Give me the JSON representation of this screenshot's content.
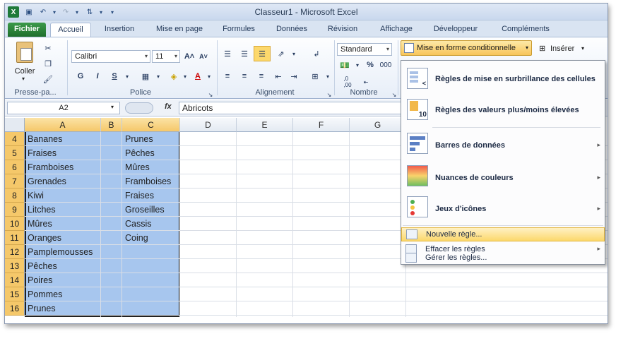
{
  "window": {
    "title": "Classeur1 - Microsoft Excel"
  },
  "tabs": [
    "Fichier",
    "Accueil",
    "Insertion",
    "Mise en page",
    "Formules",
    "Données",
    "Révision",
    "Affichage",
    "Développeur",
    "Compléments"
  ],
  "ribbon": {
    "paste_label": "Coller",
    "font_name": "Calibri",
    "font_size": "11",
    "bold": "G",
    "italic": "I",
    "underline": "S",
    "number_format": "Standard",
    "percent": "%",
    "thousands": "000",
    "dec_inc": ",0\n,00",
    "conditional_format": "Mise en forme conditionnelle",
    "insert": "Insérer",
    "groups": {
      "clipboard": "Presse-pa...",
      "font": "Police",
      "alignment": "Alignement",
      "number": "Nombre"
    }
  },
  "formula_bar": {
    "name_box": "A2",
    "fx": "fx",
    "value": "Abricots"
  },
  "columns": [
    "A",
    "B",
    "C",
    "D",
    "E",
    "F",
    "G"
  ],
  "rows": [
    {
      "n": "4",
      "a": "Bananes",
      "c": "Prunes"
    },
    {
      "n": "5",
      "a": "Fraises",
      "c": "Pêches"
    },
    {
      "n": "6",
      "a": "Framboises",
      "c": "Mûres"
    },
    {
      "n": "7",
      "a": "Grenades",
      "c": "Framboises"
    },
    {
      "n": "8",
      "a": "Kiwi",
      "c": "Fraises"
    },
    {
      "n": "9",
      "a": "Litches",
      "c": "Groseilles"
    },
    {
      "n": "10",
      "a": "Mûres",
      "c": "Cassis"
    },
    {
      "n": "11",
      "a": "Oranges",
      "c": "Coing"
    },
    {
      "n": "12",
      "a": "Pamplemousses",
      "c": ""
    },
    {
      "n": "13",
      "a": "Pêches",
      "c": ""
    },
    {
      "n": "14",
      "a": "Poires",
      "c": ""
    },
    {
      "n": "15",
      "a": "Pommes",
      "c": ""
    },
    {
      "n": "16",
      "a": "Prunes",
      "c": ""
    }
  ],
  "menu": {
    "highlight_rules": "Règles de mise en surbrillance des cellules",
    "top_bottom": "Règles des valeurs plus/moins élevées",
    "data_bars": "Barres de données",
    "color_scales": "Nuances de couleurs",
    "icon_sets": "Jeux d'icônes",
    "new_rule": "Nouvelle règle...",
    "clear_rules": "Effacer les règles",
    "manage_rules": "Gérer les règles...",
    "top_bottom_icon_number": "10"
  },
  "colors": {
    "selection": "#a7c6ee",
    "header_selected": "#f5c86a",
    "file_tab": "#2a8a3a",
    "highlight": "#fcd86c"
  }
}
